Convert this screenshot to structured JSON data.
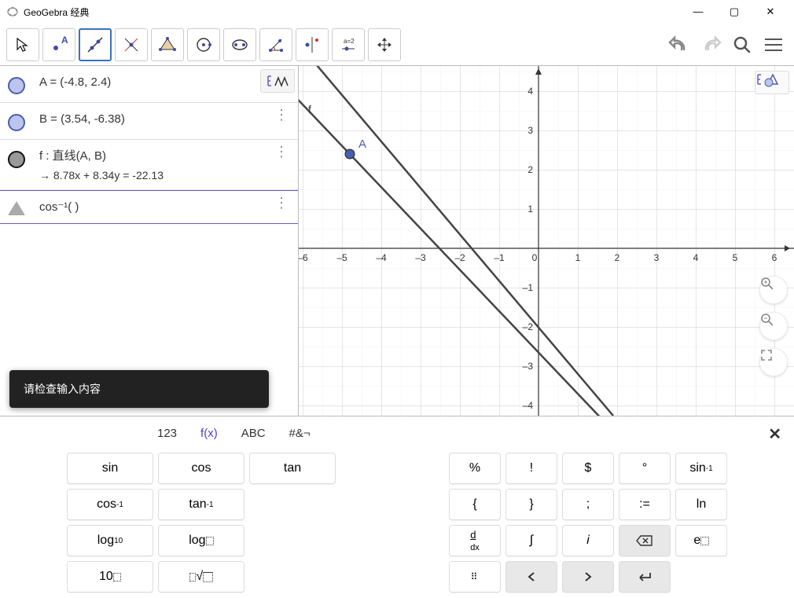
{
  "window": {
    "title": "GeoGebra 经典"
  },
  "algebra": {
    "rows": [
      {
        "label": "A = (-4.8, 2.4)"
      },
      {
        "label": "B = (3.54, -6.38)"
      },
      {
        "label": "f : 直线(A, B)",
        "sub": "→  8.78x + 8.34y = -22.13"
      },
      {
        "label": "cos⁻¹(  )"
      }
    ]
  },
  "toast": {
    "text": "请检查输入内容"
  },
  "graph": {
    "point_label": "A",
    "line_label": "f"
  },
  "keyboard": {
    "tabs": {
      "t1": "123",
      "t2": "f(x)",
      "t3": "ABC",
      "t4": "#&¬"
    },
    "keys": {
      "r1": [
        "sin",
        "cos",
        "tan",
        "",
        "%",
        "!",
        "$",
        "°"
      ],
      "r2": [
        "sin⁻¹",
        "cos⁻¹",
        "tan⁻¹",
        "",
        "{",
        "}",
        ";",
        ":="
      ],
      "r3": [
        "ln",
        "log₁₀",
        "log▯",
        "",
        "d/dx",
        "∫",
        "𝑖",
        "⌫"
      ],
      "r4": [
        "e▯",
        "10▯",
        "ⁿ√▯",
        "",
        "⠿",
        "‹",
        "›",
        "↵"
      ]
    }
  },
  "chart_data": {
    "type": "line",
    "title": "",
    "xlabel": "",
    "ylabel": "",
    "xlim": [
      -6.4,
      6.2
    ],
    "ylim": [
      -4.6,
      4.6
    ],
    "grid": true,
    "series": [
      {
        "name": "f",
        "equation": "8.78x + 8.34y = -22.13",
        "endpoints": [
          [
            -6.4,
            4.084
          ],
          [
            1.714,
            -4.458
          ]
        ]
      }
    ],
    "points": [
      {
        "name": "A",
        "x": -4.8,
        "y": 2.4
      },
      {
        "name": "B",
        "x": 3.54,
        "y": -6.38
      }
    ]
  }
}
